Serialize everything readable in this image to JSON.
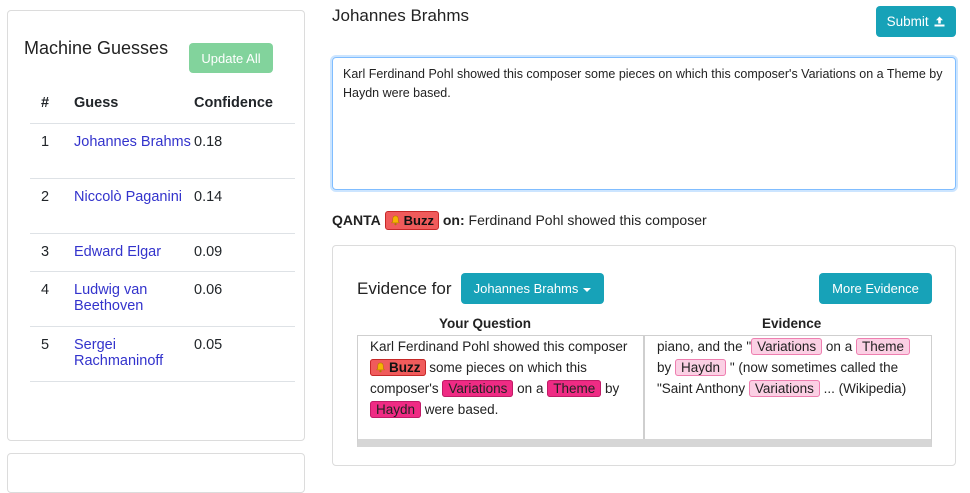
{
  "machine_guesses": {
    "title": "Machine Guesses",
    "update_all_label": "Update All",
    "columns": [
      "#",
      "Guess",
      "Confidence"
    ],
    "rows": [
      {
        "rank": "1",
        "guess": "Johannes Brahms",
        "confidence": "0.18"
      },
      {
        "rank": "2",
        "guess": "Niccolò Paganini",
        "confidence": "0.14"
      },
      {
        "rank": "3",
        "guess": "Edward Elgar",
        "confidence": "0.09"
      },
      {
        "rank": "4",
        "guess": "Ludwig van Beethoven",
        "confidence": "0.06"
      },
      {
        "rank": "5",
        "guess": "Sergei Rachmaninoff",
        "confidence": "0.05"
      }
    ]
  },
  "answer": {
    "title": "Johannes Brahms",
    "submit_label": "Submit"
  },
  "question_text": "Karl Ferdinand Pohl showed this composer some pieces on which this composer's Variations on a Theme by Haydn were based.",
  "qanta": {
    "label": "QANTA",
    "buzz_label": "Buzz",
    "on_label": "on:",
    "buzz_text": "Ferdinand Pohl showed this composer"
  },
  "evidence": {
    "title": "Evidence for",
    "dropdown_label": "Johannes Brahms",
    "more_label": "More Evidence",
    "col_question": "Your Question",
    "col_evidence": "Evidence",
    "question_parts": {
      "p1": "Karl Ferdinand Pohl showed this composer",
      "buzz": "Buzz",
      "p2": "some pieces on which this composer's",
      "variations": "Variations",
      "p3": "on a",
      "theme": "Theme",
      "p4": "by",
      "haydn": "Haydn",
      "p5": "were based."
    },
    "evidence_parts": {
      "p1": "piano, and the \"",
      "variations": "Variations",
      "p2": "on a",
      "theme": "Theme",
      "p3": "by",
      "haydn": "Haydn",
      "p4": "\" (now sometimes called the \"Saint Anthony",
      "variations2": "Variations",
      "p5": "... (Wikipedia)"
    }
  },
  "colors": {
    "info": "#17a2b8",
    "success_light": "#82d39c",
    "buzz_red": "#f05b5b",
    "highlight_strong": "#ef2b84",
    "highlight_light": "#fbd0e4",
    "link": "#3333cc"
  },
  "icons": {
    "submit": "upload-icon",
    "buzz": "bell-icon",
    "dropdown": "caret-down-icon"
  }
}
